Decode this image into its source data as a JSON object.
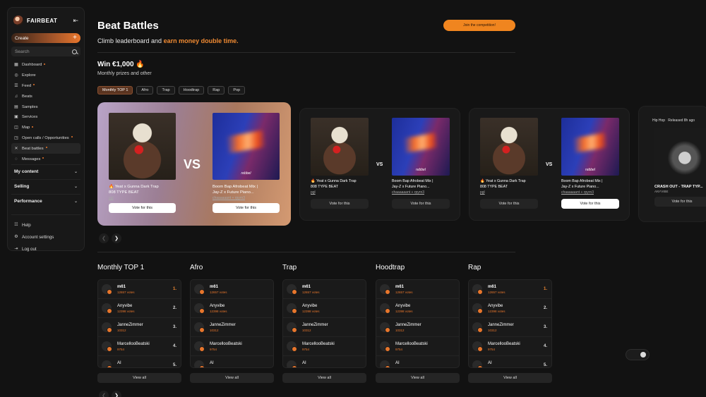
{
  "sidebar": {
    "brand": "FAIRBEAT",
    "create_label": "Create",
    "search_placeholder": "Search",
    "items": [
      {
        "label": "Dashboard",
        "icon": "dashboard-icon",
        "dot": true
      },
      {
        "label": "Explore",
        "icon": "explore-icon",
        "dot": false
      },
      {
        "label": "Feed",
        "icon": "feed-icon",
        "dot": true
      },
      {
        "label": "Beats",
        "icon": "music-note-icon",
        "dot": false
      },
      {
        "label": "Samples",
        "icon": "samples-icon",
        "dot": false
      },
      {
        "label": "Services",
        "icon": "services-icon",
        "dot": false
      },
      {
        "label": "Map",
        "icon": "map-icon",
        "dot": true
      },
      {
        "label": "Open calls / Opportunities",
        "icon": "opportunities-icon",
        "dot": true
      },
      {
        "label": "Beat battles",
        "icon": "battle-icon",
        "dot": true
      },
      {
        "label": "Messages",
        "icon": "message-icon",
        "dot": true
      }
    ],
    "sections": [
      "My content",
      "Selling",
      "Performance"
    ],
    "bottom": [
      {
        "label": "Help",
        "icon": "help-icon"
      },
      {
        "label": "Account settings",
        "icon": "gear-icon"
      },
      {
        "label": "Log out",
        "icon": "logout-icon"
      }
    ]
  },
  "header": {
    "title": "Beat Battles",
    "subtitle_prefix": "Climb leaderboard and ",
    "subtitle_highlight": "earn money double time.",
    "join_label": "Join the competition!"
  },
  "prize": {
    "title": "Win €1,000 🔥",
    "subtitle": "Monthly prizes and other"
  },
  "filters": [
    "Monthly TOP 1",
    "Afro",
    "Trap",
    "Hoodtrap",
    "Rap",
    "Pop"
  ],
  "battles": {
    "vs": "VS",
    "vote_label": "Vote for this",
    "left": {
      "title1": "🔥 Yeat x Gunna Dark Trap",
      "title2": "808 TYPE BEAT",
      "author": "pgl"
    },
    "right": {
      "title1": "Boom Bap Afrobeat Mix |",
      "title2": "Jay-Z x Future Piano...",
      "author": "chaaaaaant + rpyrn3",
      "label": "rebbel"
    },
    "partial": {
      "genre": "Hip Hop",
      "released": "Released 8h ago",
      "title": "CRASH OUT - TRAP TYP...",
      "author": "ANYVIBE"
    }
  },
  "leaderboards": {
    "view_all": "View all",
    "boards": [
      "Monthly TOP 1",
      "Afro",
      "Trap",
      "Hoodtrap",
      "Rap"
    ],
    "rows": [
      {
        "name": "m61",
        "votes": "12657 votes",
        "rank": "1."
      },
      {
        "name": "Anyvibe",
        "votes": "12398 votes",
        "rank": "2."
      },
      {
        "name": "JanneZimmer",
        "votes": "10312",
        "rank": "3."
      },
      {
        "name": "MarcellooBeatski",
        "votes": "9754",
        "rank": "4."
      },
      {
        "name": "AI",
        "votes": "",
        "rank": "5."
      }
    ]
  }
}
